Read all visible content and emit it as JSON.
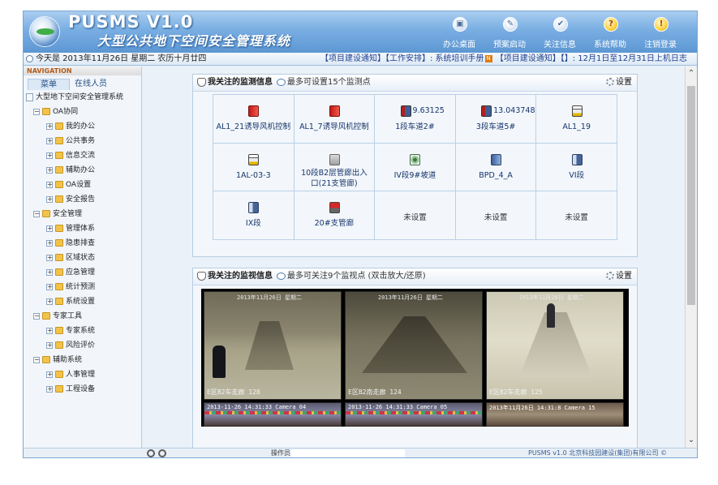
{
  "header": {
    "title": "PUSMS V1.0",
    "subtitle": "大型公共地下空间安全管理系统",
    "toolbar": [
      {
        "label": "办公桌面",
        "icon": "desk-icon",
        "glyph": "▣"
      },
      {
        "label": "预案启动",
        "icon": "launch-icon",
        "glyph": "✎"
      },
      {
        "label": "关注信息",
        "icon": "focus-icon",
        "glyph": "✔"
      },
      {
        "label": "系统帮助",
        "icon": "help-icon",
        "glyph": "?"
      },
      {
        "label": "注销登录",
        "icon": "logout-icon",
        "glyph": "!"
      }
    ]
  },
  "infobar": {
    "date": "今天是 2013年11月26日 星期二 农历十月廿四",
    "notice_before": "【项目建设通知】【工作安排】: 系统培训手册",
    "notice_after": "  【项目建设通知】【】: 12月1日至12月31日上机日志",
    "new_badge": "N"
  },
  "sidebar": {
    "nav_title": "NAVIGATION",
    "tabs": [
      "菜单",
      "在线人员"
    ],
    "root": "大型地下空间安全管理系统",
    "groups": [
      {
        "label": "OA协同",
        "items": [
          "我的办公",
          "公共事务",
          "信息交流",
          "辅助办公",
          "OA设置",
          "安全报告"
        ]
      },
      {
        "label": "安全管理",
        "items": [
          "管理体系",
          "隐患排查",
          "区域状态",
          "应急管理",
          "统计预测",
          "系统设置"
        ]
      },
      {
        "label": "专家工具",
        "items": [
          "专家系统",
          "风险评价"
        ]
      },
      {
        "label": "辅助系统",
        "items": [
          "人事管理",
          "工程设备"
        ]
      }
    ]
  },
  "monitor_panel": {
    "title": "我关注的监测信息",
    "note": "最多可设置15个监测点",
    "settings": "设置",
    "cells": [
      {
        "label": "AL1_21诱导风机控制",
        "value": "",
        "icon": "red-equipment-icon",
        "kind": "ico-red"
      },
      {
        "label": "AL1_7诱导风机控制",
        "value": "",
        "icon": "red-equipment-icon",
        "kind": "ico-red"
      },
      {
        "label": "1段车道2#",
        "value": "9.63125",
        "icon": "elevator-icon",
        "kind": "ico-elev"
      },
      {
        "label": "3段车道5#",
        "value": "13.043748",
        "icon": "elevator-icon",
        "kind": "ico-elev"
      },
      {
        "label": "AL1_19",
        "value": "",
        "icon": "server-icon",
        "kind": "ico-server"
      },
      {
        "label": "1AL-03-3",
        "value": "",
        "icon": "server-icon",
        "kind": "ico-server"
      },
      {
        "label": "10段B2层管廊出入口(21支管廊)",
        "value": "",
        "icon": "box-icon",
        "kind": "ico-box"
      },
      {
        "label": "IV段9#坡道",
        "value": "",
        "icon": "fan-icon",
        "kind": "ico-fan"
      },
      {
        "label": "BPD_4_A",
        "value": "",
        "icon": "device-icon",
        "kind": "ico-blue"
      },
      {
        "label": "VI段",
        "value": "",
        "icon": "door-icon",
        "kind": "ico-door"
      },
      {
        "label": "IX段",
        "value": "",
        "icon": "door-icon",
        "kind": "ico-door"
      },
      {
        "label": "20#支管廊",
        "value": "",
        "icon": "alarm-icon",
        "kind": "ico-alarm"
      },
      {
        "label": "",
        "value": "",
        "unset": "未设置"
      },
      {
        "label": "",
        "value": "",
        "unset": "未设置"
      },
      {
        "label": "",
        "value": "",
        "unset": "未设置"
      }
    ]
  },
  "video_panel": {
    "title": "我关注的监视信息",
    "note": "最多可关注9个监视点 (双击放大/还原)",
    "settings": "设置",
    "feeds": [
      {
        "time": "2013年11月26日 星期二",
        "label": "E区B2车走廊 128"
      },
      {
        "time": "2013年11月26日 星期二",
        "label": "E区B2南走廊 124"
      },
      {
        "time": "2013年11月26日 星期二",
        "label": "E区B2车走廊 125"
      }
    ],
    "feeds_bottom": [
      {
        "time": "2013-11-26  14:31:33  Camera 04"
      },
      {
        "time": "2013-11-26  14:31:33  Camera 05"
      },
      {
        "time": "2013年11月26日  14:31:8  Camera 15"
      }
    ]
  },
  "statusbar": {
    "operator_label": "操作员:",
    "copyright": "PUSMS v1.0 北京科技园建设(集团)有限公司 ©"
  }
}
